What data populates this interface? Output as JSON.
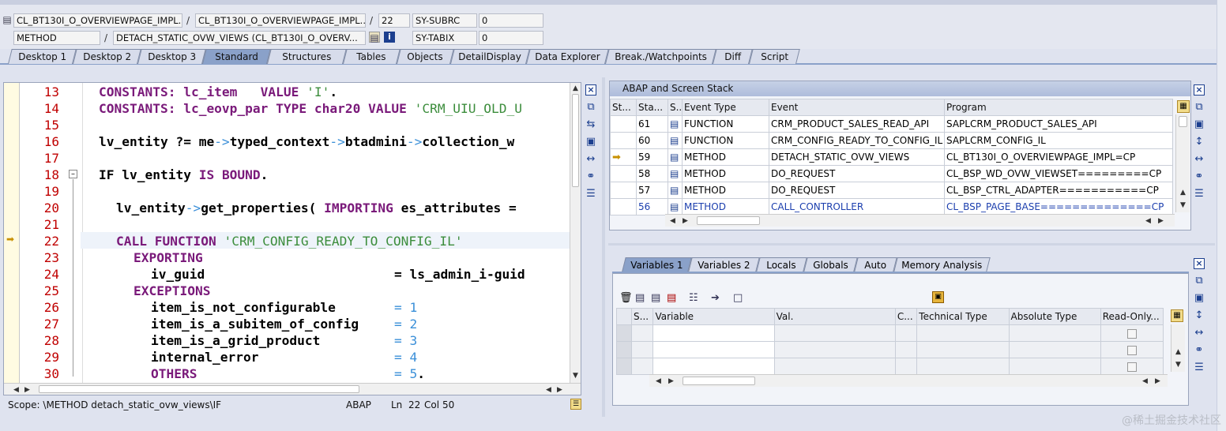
{
  "header": {
    "row1": {
      "field1": "CL_BT130I_O_OVERVIEWPAGE_IMPL...",
      "field2": "CL_BT130I_O_OVERVIEWPAGE_IMPL...",
      "line": "22",
      "sysvar": "SY-SUBRC",
      "sysval": "0"
    },
    "row2": {
      "field1": "METHOD",
      "field2": "DETACH_STATIC_OVW_VIEWS (CL_BT130I_O_OVERV...",
      "sysvar": "SY-TABIX",
      "sysval": "0"
    },
    "separator": "/"
  },
  "tabs": [
    "Desktop 1",
    "Desktop 2",
    "Desktop 3",
    "Standard",
    "Structures",
    "Tables",
    "Objects",
    "DetailDisplay",
    "Data Explorer",
    "Break./Watchpoints",
    "Diff",
    "Script"
  ],
  "editor": {
    "line_numbers": [
      "13",
      "14",
      "15",
      "16",
      "17",
      "18",
      "19",
      "20",
      "21",
      "22",
      "23",
      "24",
      "25",
      "26",
      "27",
      "28",
      "29",
      "30"
    ],
    "lines": {
      "l13a": "CONSTANTS: lc_item   VALUE ",
      "l13b": "'I'",
      "l13c": ".",
      "l14a": "CONSTANTS: lc_eovp_par TYPE char20 VALUE ",
      "l14b": "'CRM_UIU_OLD_U",
      "l16a": "lv_entity ?= me",
      "l16b": "->",
      "l16c": "typed_context",
      "l16d": "->",
      "l16e": "btadmini",
      "l16f": "->",
      "l16g": "collection_w",
      "l18a": "IF",
      "l18b": " lv_entity ",
      "l18c": "IS BOUND",
      "l18d": ".",
      "l20a": "lv_entity",
      "l20b": "->",
      "l20c": "get_properties(",
      "l20d": " IMPORTING ",
      "l20e": "es_attributes =",
      "l22a": "CALL FUNCTION ",
      "l22b": "'CRM_CONFIG_READY_TO_CONFIG_IL'",
      "l23": "EXPORTING",
      "l24a": "iv_guid",
      "l24b": "= ls_admin_i-guid",
      "l25": "EXCEPTIONS",
      "l26a": "item_is_not_configurable",
      "l26b": "=",
      "l26c": "1",
      "l27a": "item_is_a_subitem_of_config",
      "l27b": "=",
      "l27c": "2",
      "l28a": "item_is_a_grid_product",
      "l28b": "=",
      "l28c": "3",
      "l29a": "internal_error",
      "l29b": "=",
      "l29c": "4",
      "l30a": "OTHERS",
      "l30b": "=",
      "l30c": "5",
      "l30d": "."
    }
  },
  "status": {
    "scope": "Scope: \\METHOD detach_static_ovw_views\\IF",
    "lang": "ABAP",
    "ln_label": "Ln",
    "ln": "22",
    "col_label": "Col",
    "col": "50"
  },
  "stack": {
    "title": "ABAP and Screen Stack",
    "columns": [
      "St...",
      "Sta...",
      "S...",
      "Event Type",
      "Event",
      "Program"
    ],
    "rows": [
      {
        "sta": "61",
        "type": "FUNCTION",
        "event": "CRM_PRODUCT_SALES_READ_API",
        "program": "SAPLCRM_PRODUCT_SALES_API"
      },
      {
        "sta": "60",
        "type": "FUNCTION",
        "event": "CRM_CONFIG_READY_TO_CONFIG_IL",
        "program": "SAPLCRM_CONFIG_IL"
      },
      {
        "sta": "59",
        "type": "METHOD",
        "event": "DETACH_STATIC_OVW_VIEWS",
        "program": "CL_BT130I_O_OVERVIEWPAGE_IMPL=CP"
      },
      {
        "sta": "58",
        "type": "METHOD",
        "event": "DO_REQUEST",
        "program": "CL_BSP_WD_OVW_VIEWSET=========CP"
      },
      {
        "sta": "57",
        "type": "METHOD",
        "event": "DO_REQUEST",
        "program": "CL_BSP_CTRL_ADAPTER===========CP"
      },
      {
        "sta": "56",
        "type": "METHOD",
        "event": "CALL_CONTROLLER",
        "program": "CL_BSP_PAGE_BASE==============CP"
      }
    ]
  },
  "vars": {
    "tabs": [
      "Variables 1",
      "Variables 2",
      "Locals",
      "Globals",
      "Auto",
      "Memory Analysis"
    ],
    "columns": [
      "S...",
      "Variable",
      "Val.",
      "C...",
      "Technical Type",
      "Absolute Type",
      "Read-Only..."
    ]
  },
  "watermark": "@稀土掘金技术社区",
  "colors": {
    "accent": "#8aa1c9",
    "linenum": "#c00000",
    "keyword": "#7a1a7a",
    "string": "#3c8d3c",
    "number": "#3a8fd8",
    "link": "#1c3fae"
  }
}
